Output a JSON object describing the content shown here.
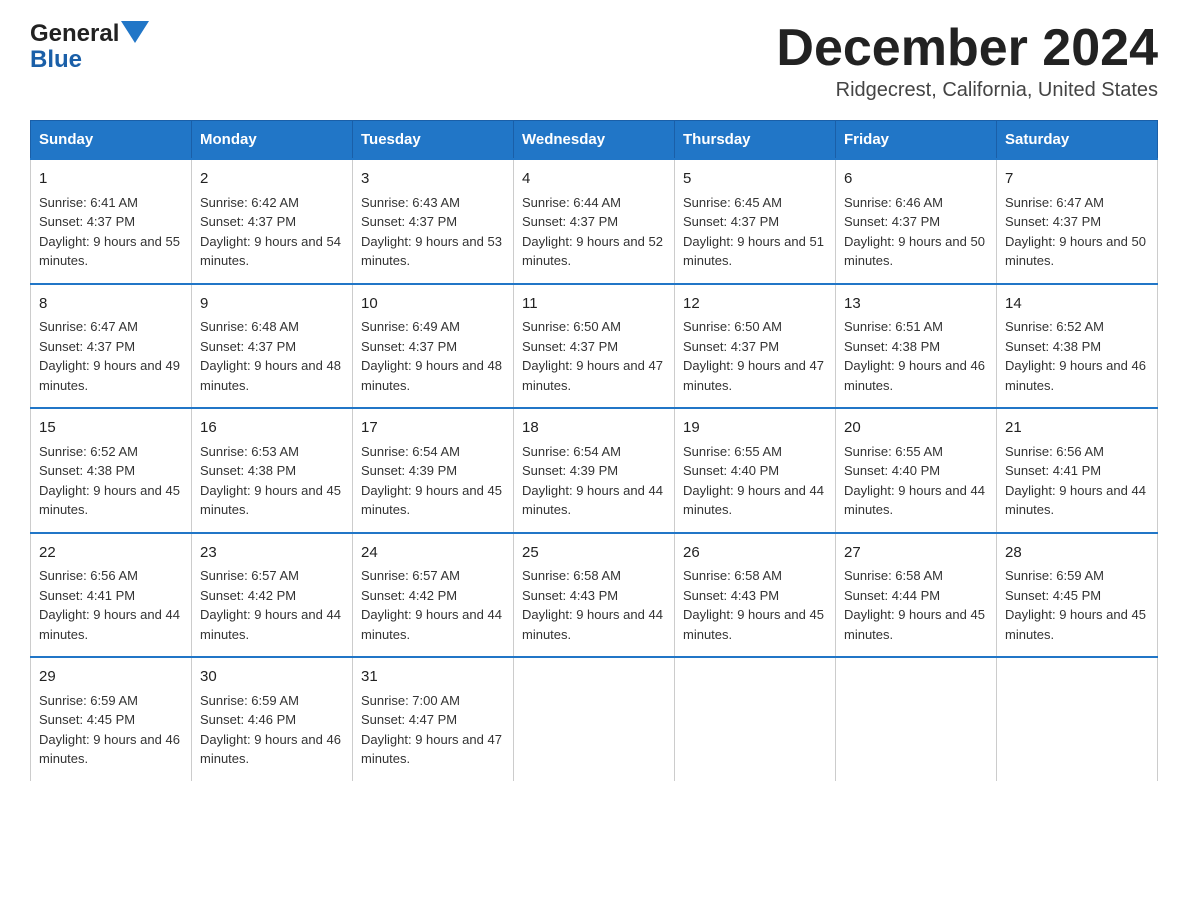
{
  "header": {
    "logo_line1": "General",
    "logo_line2": "Blue",
    "month_title": "December 2024",
    "location": "Ridgecrest, California, United States"
  },
  "days_of_week": [
    "Sunday",
    "Monday",
    "Tuesday",
    "Wednesday",
    "Thursday",
    "Friday",
    "Saturday"
  ],
  "weeks": [
    [
      {
        "day": "1",
        "sunrise": "6:41 AM",
        "sunset": "4:37 PM",
        "daylight": "9 hours and 55 minutes."
      },
      {
        "day": "2",
        "sunrise": "6:42 AM",
        "sunset": "4:37 PM",
        "daylight": "9 hours and 54 minutes."
      },
      {
        "day": "3",
        "sunrise": "6:43 AM",
        "sunset": "4:37 PM",
        "daylight": "9 hours and 53 minutes."
      },
      {
        "day": "4",
        "sunrise": "6:44 AM",
        "sunset": "4:37 PM",
        "daylight": "9 hours and 52 minutes."
      },
      {
        "day": "5",
        "sunrise": "6:45 AM",
        "sunset": "4:37 PM",
        "daylight": "9 hours and 51 minutes."
      },
      {
        "day": "6",
        "sunrise": "6:46 AM",
        "sunset": "4:37 PM",
        "daylight": "9 hours and 50 minutes."
      },
      {
        "day": "7",
        "sunrise": "6:47 AM",
        "sunset": "4:37 PM",
        "daylight": "9 hours and 50 minutes."
      }
    ],
    [
      {
        "day": "8",
        "sunrise": "6:47 AM",
        "sunset": "4:37 PM",
        "daylight": "9 hours and 49 minutes."
      },
      {
        "day": "9",
        "sunrise": "6:48 AM",
        "sunset": "4:37 PM",
        "daylight": "9 hours and 48 minutes."
      },
      {
        "day": "10",
        "sunrise": "6:49 AM",
        "sunset": "4:37 PM",
        "daylight": "9 hours and 48 minutes."
      },
      {
        "day": "11",
        "sunrise": "6:50 AM",
        "sunset": "4:37 PM",
        "daylight": "9 hours and 47 minutes."
      },
      {
        "day": "12",
        "sunrise": "6:50 AM",
        "sunset": "4:37 PM",
        "daylight": "9 hours and 47 minutes."
      },
      {
        "day": "13",
        "sunrise": "6:51 AM",
        "sunset": "4:38 PM",
        "daylight": "9 hours and 46 minutes."
      },
      {
        "day": "14",
        "sunrise": "6:52 AM",
        "sunset": "4:38 PM",
        "daylight": "9 hours and 46 minutes."
      }
    ],
    [
      {
        "day": "15",
        "sunrise": "6:52 AM",
        "sunset": "4:38 PM",
        "daylight": "9 hours and 45 minutes."
      },
      {
        "day": "16",
        "sunrise": "6:53 AM",
        "sunset": "4:38 PM",
        "daylight": "9 hours and 45 minutes."
      },
      {
        "day": "17",
        "sunrise": "6:54 AM",
        "sunset": "4:39 PM",
        "daylight": "9 hours and 45 minutes."
      },
      {
        "day": "18",
        "sunrise": "6:54 AM",
        "sunset": "4:39 PM",
        "daylight": "9 hours and 44 minutes."
      },
      {
        "day": "19",
        "sunrise": "6:55 AM",
        "sunset": "4:40 PM",
        "daylight": "9 hours and 44 minutes."
      },
      {
        "day": "20",
        "sunrise": "6:55 AM",
        "sunset": "4:40 PM",
        "daylight": "9 hours and 44 minutes."
      },
      {
        "day": "21",
        "sunrise": "6:56 AM",
        "sunset": "4:41 PM",
        "daylight": "9 hours and 44 minutes."
      }
    ],
    [
      {
        "day": "22",
        "sunrise": "6:56 AM",
        "sunset": "4:41 PM",
        "daylight": "9 hours and 44 minutes."
      },
      {
        "day": "23",
        "sunrise": "6:57 AM",
        "sunset": "4:42 PM",
        "daylight": "9 hours and 44 minutes."
      },
      {
        "day": "24",
        "sunrise": "6:57 AM",
        "sunset": "4:42 PM",
        "daylight": "9 hours and 44 minutes."
      },
      {
        "day": "25",
        "sunrise": "6:58 AM",
        "sunset": "4:43 PM",
        "daylight": "9 hours and 44 minutes."
      },
      {
        "day": "26",
        "sunrise": "6:58 AM",
        "sunset": "4:43 PM",
        "daylight": "9 hours and 45 minutes."
      },
      {
        "day": "27",
        "sunrise": "6:58 AM",
        "sunset": "4:44 PM",
        "daylight": "9 hours and 45 minutes."
      },
      {
        "day": "28",
        "sunrise": "6:59 AM",
        "sunset": "4:45 PM",
        "daylight": "9 hours and 45 minutes."
      }
    ],
    [
      {
        "day": "29",
        "sunrise": "6:59 AM",
        "sunset": "4:45 PM",
        "daylight": "9 hours and 46 minutes."
      },
      {
        "day": "30",
        "sunrise": "6:59 AM",
        "sunset": "4:46 PM",
        "daylight": "9 hours and 46 minutes."
      },
      {
        "day": "31",
        "sunrise": "7:00 AM",
        "sunset": "4:47 PM",
        "daylight": "9 hours and 47 minutes."
      },
      null,
      null,
      null,
      null
    ]
  ]
}
